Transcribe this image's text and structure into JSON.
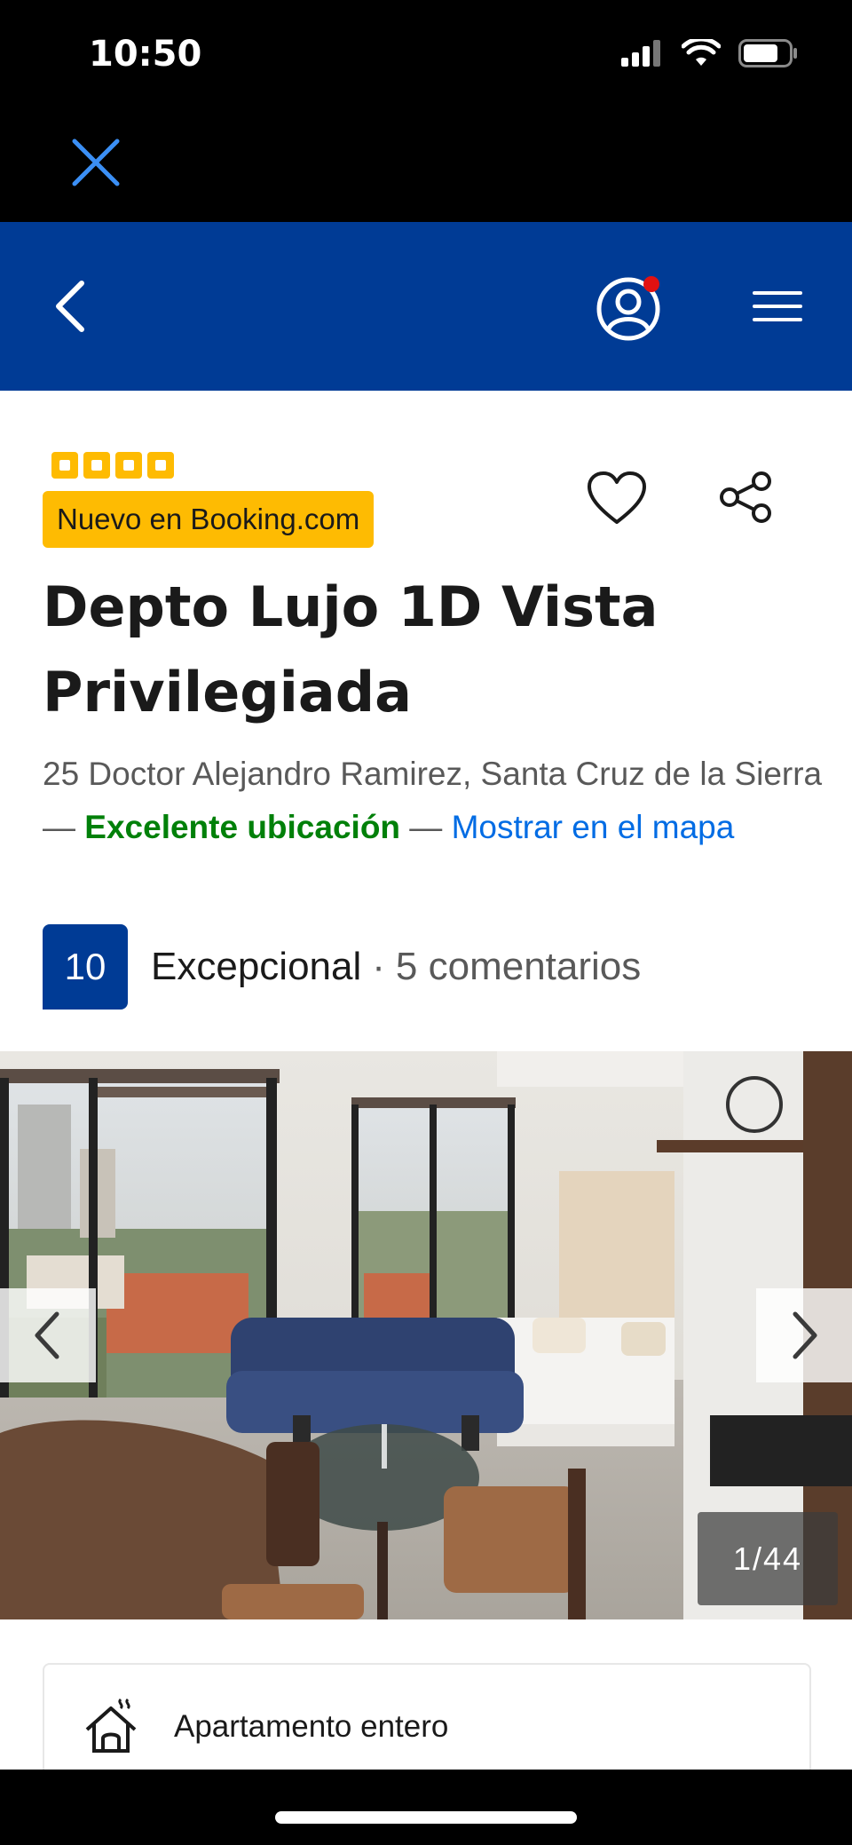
{
  "status_bar": {
    "time": "10:50"
  },
  "browser": {
    "title": "Depto Lujo 1D Vista Privilegi..."
  },
  "property": {
    "star_rating": 4,
    "badge": "Nuevo en Booking.com",
    "name": "Depto Lujo 1D Vista Privilegiada",
    "address": "25 Doctor Alejandro Ramirez, Santa Cruz de la Sierra",
    "separator": " — ",
    "location_label": "Excelente ubicación",
    "map_link": "Mostrar en el mapa",
    "score": "10",
    "score_word": "Excepcional",
    "reviews": "5 comentarios"
  },
  "gallery": {
    "counter": "1/44"
  },
  "facilities": [
    {
      "icon": "house-heating-icon",
      "label": "Apartamento entero"
    }
  ],
  "colors": {
    "brand_blue": "#003b95",
    "badge_yellow": "#febb02",
    "good_green": "#008009",
    "link_blue": "#006ce4",
    "notification_red": "#e21111"
  }
}
